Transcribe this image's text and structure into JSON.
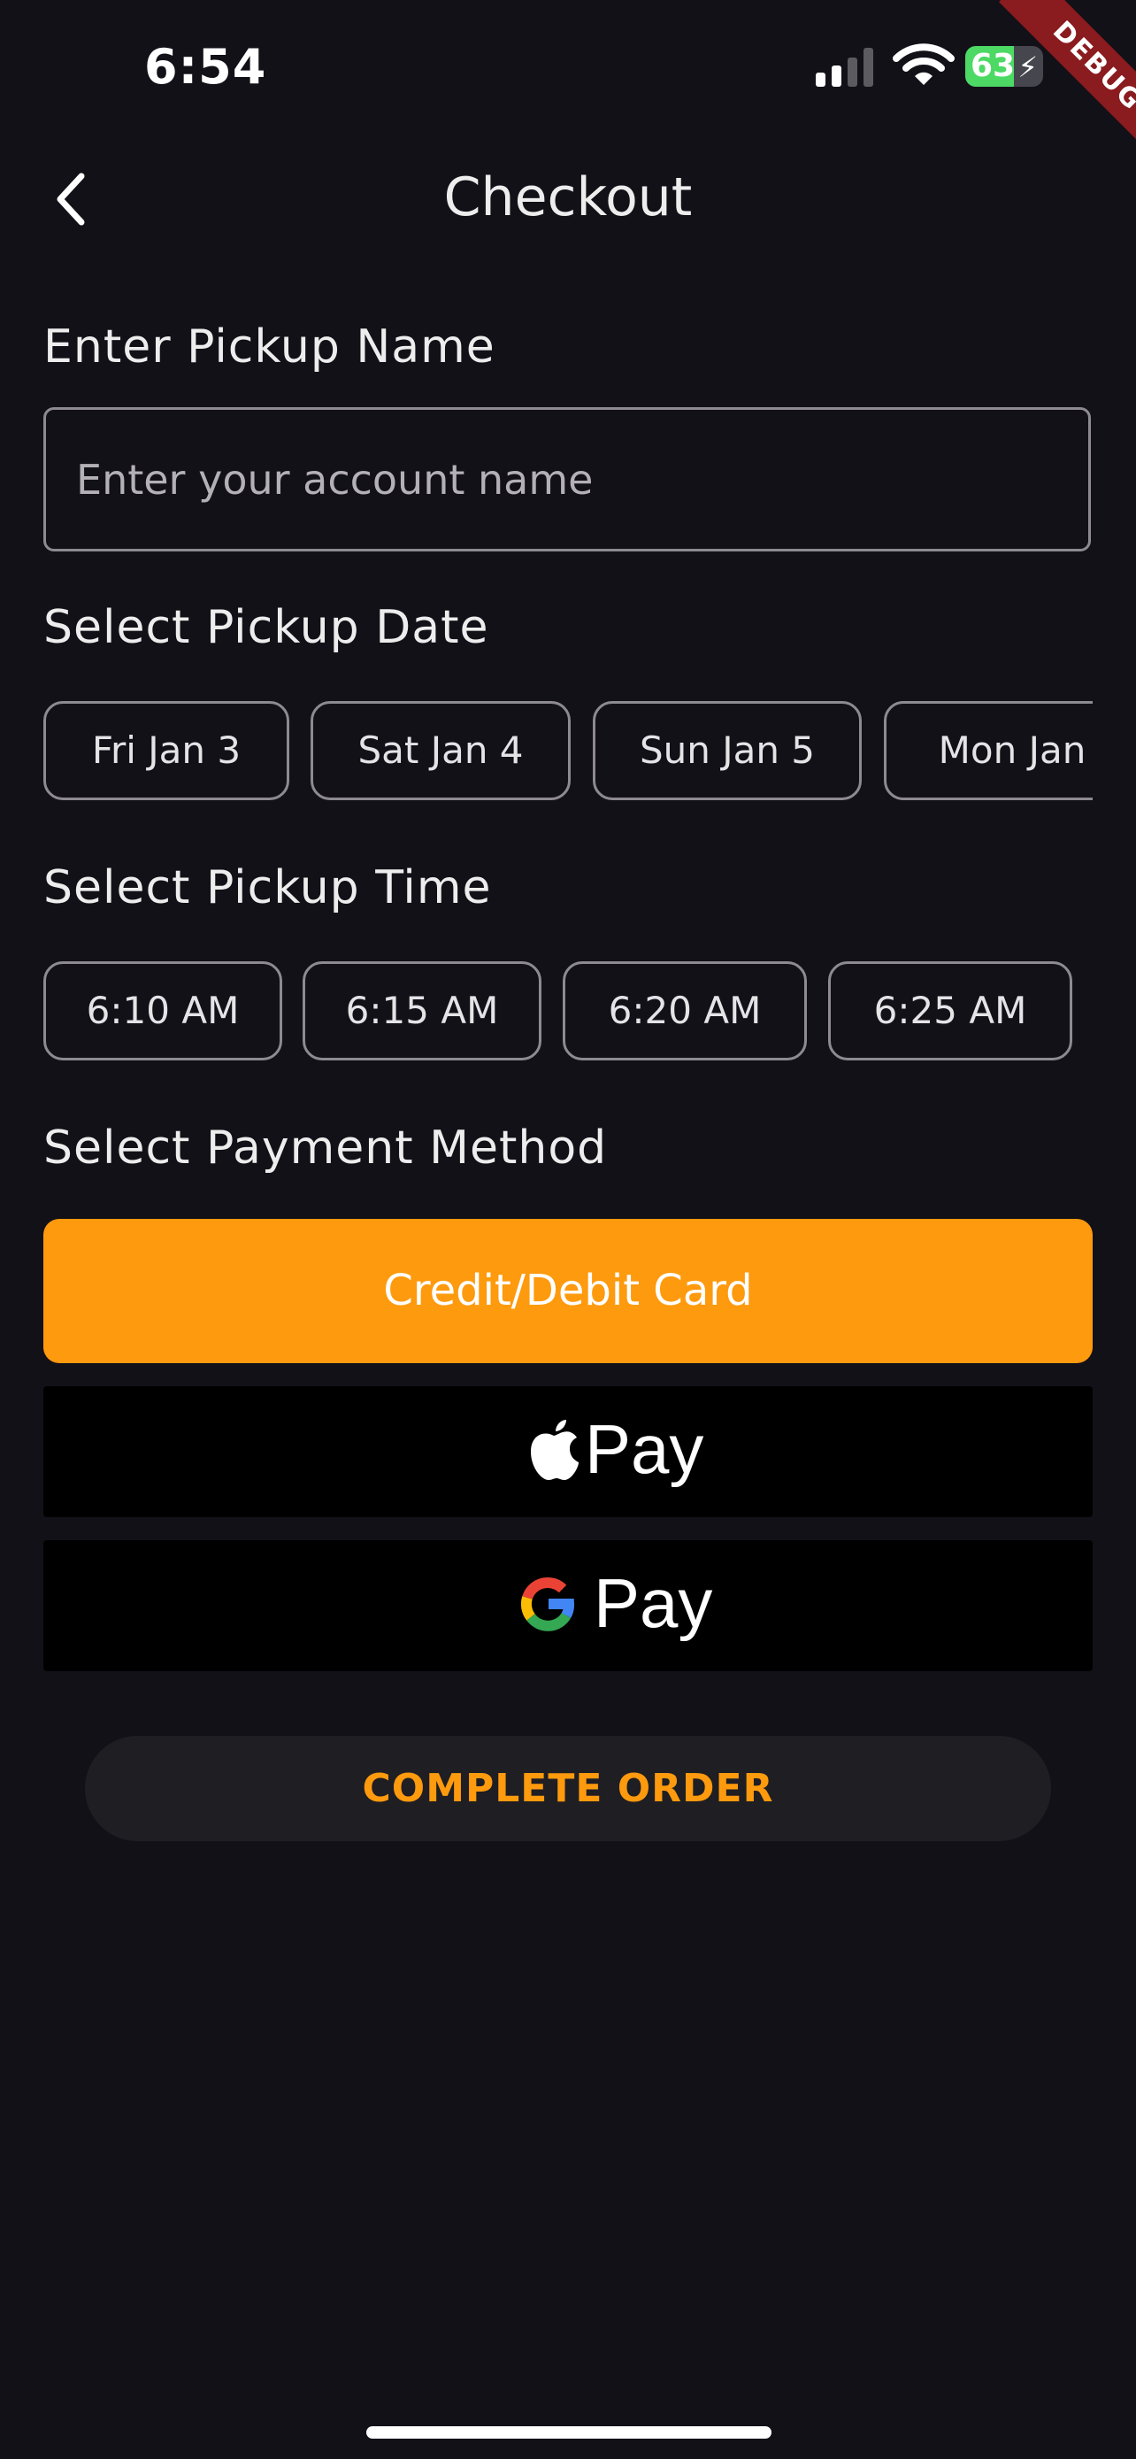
{
  "status_bar": {
    "time": "6:54",
    "battery_level": "63",
    "battery_fraction": 0.63,
    "icons": [
      "cellular-signal-icon",
      "wifi-icon",
      "battery-charging-icon"
    ]
  },
  "debug_banner": "DEBUG",
  "header": {
    "title": "Checkout",
    "back_icon": "chevron-left-icon"
  },
  "pickup_name": {
    "label": "Enter Pickup Name",
    "value": "",
    "placeholder": "Enter your account name"
  },
  "pickup_date": {
    "label": "Select Pickup Date",
    "options": [
      "Fri Jan 3",
      "Sat Jan 4",
      "Sun Jan 5",
      "Mon Jan"
    ]
  },
  "pickup_time": {
    "label": "Select Pickup Time",
    "options": [
      "6:10 AM",
      "6:15 AM",
      "6:20 AM",
      "6:25 AM"
    ]
  },
  "payment": {
    "label": "Select Payment Method",
    "card_label": "Credit/Debit Card",
    "apple_pay_label": "Pay",
    "google_pay_label": "Pay",
    "accent_color": "#FE9A0E"
  },
  "complete_order_label": "COMPLETE ORDER",
  "colors": {
    "background": "#131118",
    "accent": "#FE9A0E",
    "chip_border": "#8D8B91",
    "button_dark": "#1F1E23",
    "debug_ribbon": "#8A1B1F",
    "battery_green": "#4CD964"
  }
}
